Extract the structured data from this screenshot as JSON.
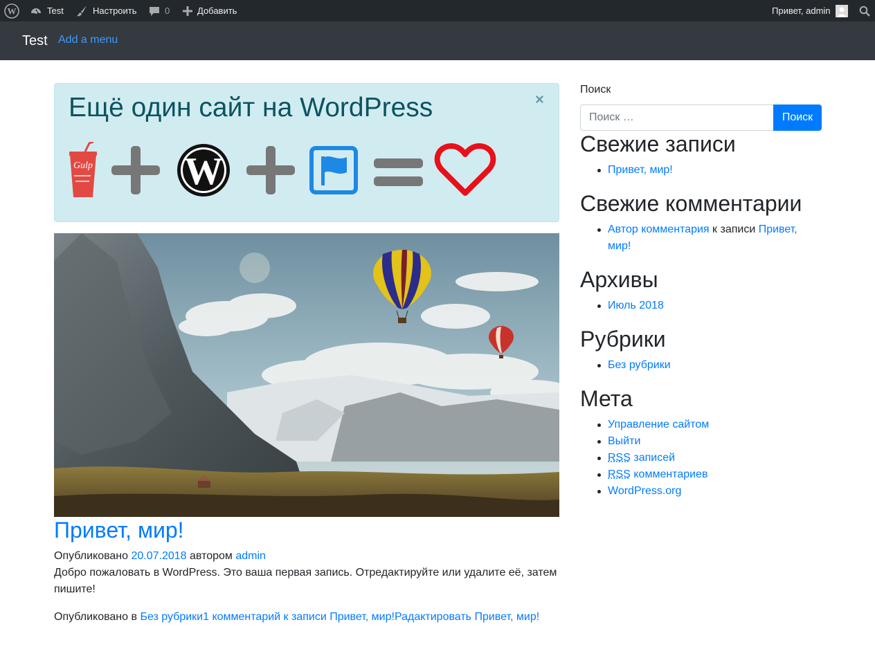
{
  "admin_bar": {
    "site_name": "Test",
    "customize": "Настроить",
    "comments_count": "0",
    "add_new": "Добавить",
    "greeting": "Привет, admin"
  },
  "navbar": {
    "brand": "Test",
    "add_menu": "Add a menu"
  },
  "header": {
    "title": "Ещё один сайт на WordPress",
    "close": "×",
    "logos": [
      "gulp-logo",
      "plus-icon",
      "wordpress-logo",
      "plus-icon",
      "bootstrap-flag-icon",
      "equals-icon",
      "heart-icon"
    ],
    "gulp_text": "Gulp"
  },
  "post": {
    "title": "Привет, мир!",
    "meta_prefix": "Опубликовано",
    "date": "20.07.2018",
    "author_prefix": "автором",
    "author": "admin",
    "excerpt": "Добро пожаловать в WordPress. Это ваша первая запись. Отредактируйте или удалите её, затем пишите!",
    "footer_prefix": "Опубликовано в",
    "category": "Без рубрики",
    "comments_link": "1 комментарий к записи Привет, мир!",
    "edit_link": "Радактировать Привет, мир!"
  },
  "sidebar": {
    "search_label": "Поиск",
    "search_placeholder": "Поиск …",
    "search_button": "Поиск",
    "recent_posts": {
      "title": "Свежие записи",
      "items": [
        "Привет, мир!"
      ]
    },
    "recent_comments": {
      "title": "Свежие комментарии",
      "author": "Автор комментария",
      "connector": "к записи",
      "post": "Привет, мир!"
    },
    "archives": {
      "title": "Архивы",
      "items": [
        "Июль 2018"
      ]
    },
    "categories": {
      "title": "Рубрики",
      "items": [
        "Без рубрики"
      ]
    },
    "meta": {
      "title": "Мета",
      "items": [
        "Управление сайтом",
        "Выйти"
      ],
      "rss_abbr": "RSS",
      "rss_posts": "записей",
      "rss_comments": "комментариев",
      "wordpress_org": "WordPress.org"
    }
  },
  "colors": {
    "link": "#007bff",
    "admin_bar_bg": "#23282d",
    "navbar_bg": "#343a40",
    "alert_bg": "#d1ecf1",
    "alert_text": "#0c5460",
    "heart": "#e8101a",
    "flag": "#1e88e5"
  }
}
